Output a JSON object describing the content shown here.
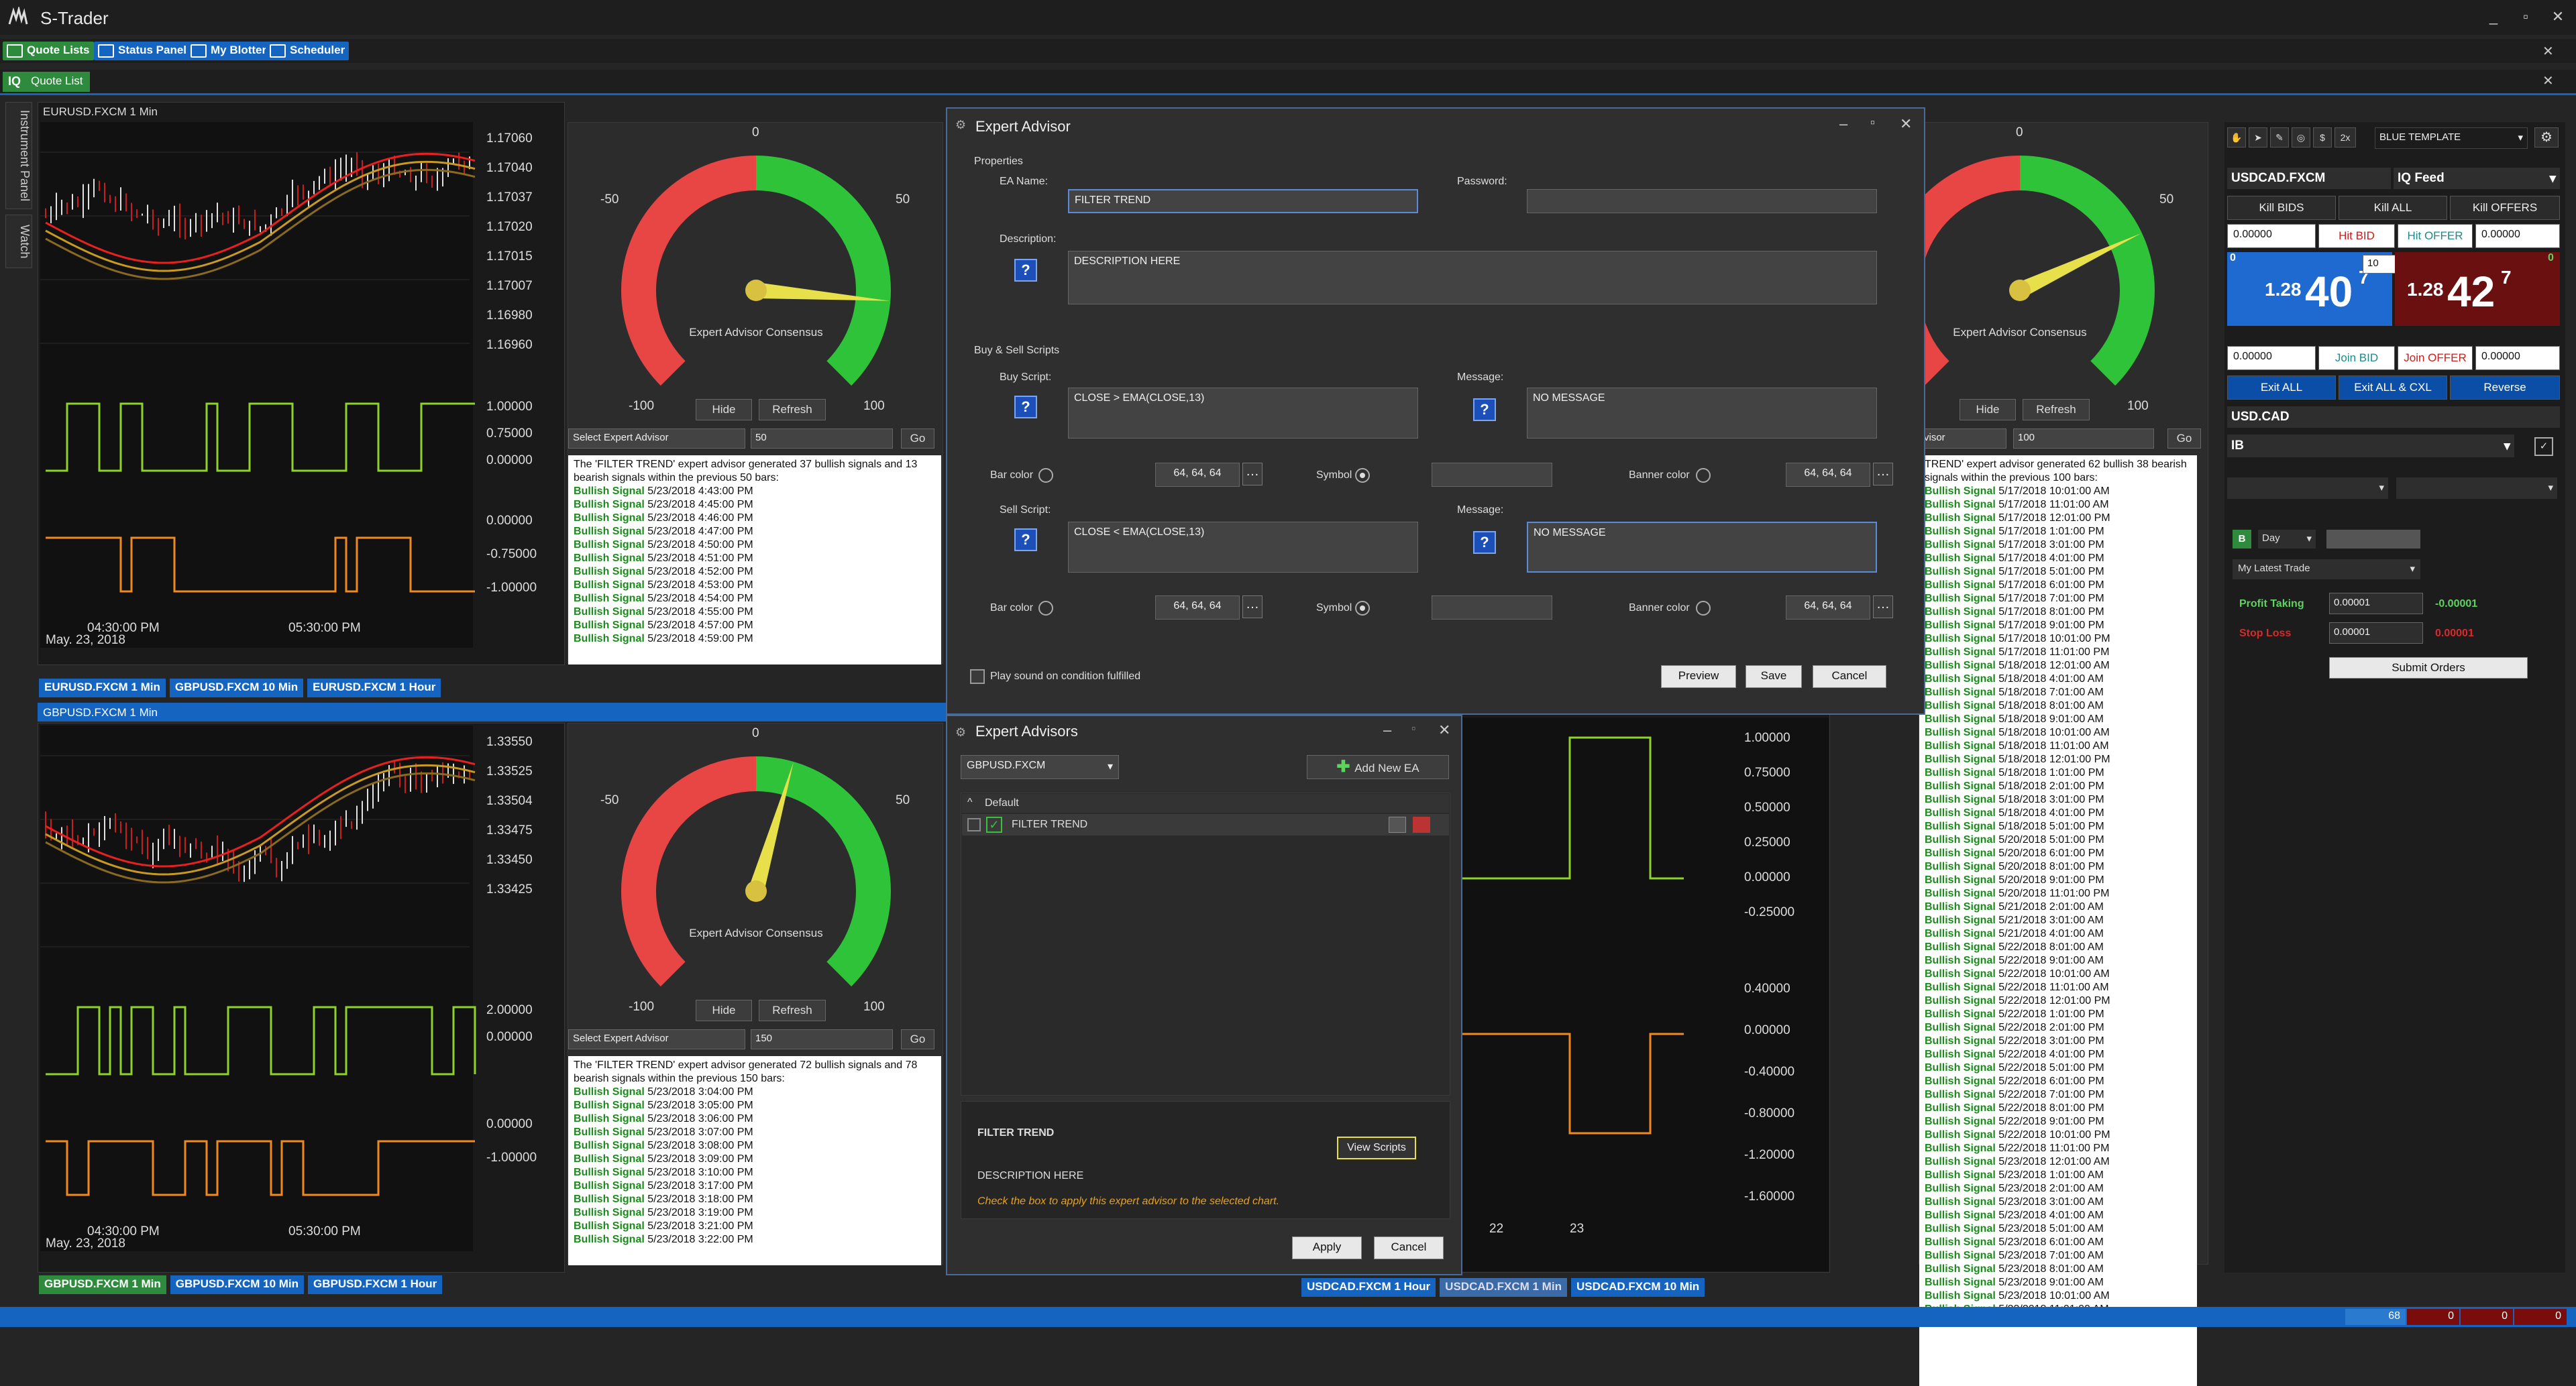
{
  "app": {
    "title": "S-Trader"
  },
  "menu": {
    "quote_lists": "Quote Lists",
    "status_panel": "Status Panel",
    "my_blotter": "My Blotter",
    "scheduler": "Scheduler"
  },
  "tabs": {
    "quote_list": "Quote List"
  },
  "side_tabs": {
    "instrument_panel": "Instrument Panel",
    "watch": "Watch"
  },
  "chart_top": {
    "title": "EURUSD.FXCM 1 Min",
    "price_ticks": [
      "1.17060",
      "1.17040",
      "1.17037",
      "1.17020",
      "1.17015",
      "1.17007",
      "1.16980",
      "1.16960"
    ],
    "ind1_ticks": [
      "1.00000",
      "0.75000",
      "0.00000"
    ],
    "ind2_ticks": [
      "0.00000",
      "-0.75000",
      "-1.00000"
    ],
    "time_ticks": [
      "04:30:00 PM",
      "05:30:00 PM"
    ],
    "date": "May. 23, 2018",
    "tabs": [
      "EURUSD.FXCM 1 Min",
      "GBPUSD.FXCM 10 Min",
      "EURUSD.FXCM 1 Hour"
    ]
  },
  "chart_bottom": {
    "title": "GBPUSD.FXCM 1 Min",
    "price_ticks": [
      "1.33550",
      "1.33525",
      "1.33504",
      "1.33475",
      "1.33450",
      "1.33425"
    ],
    "ind1_ticks": [
      "2.00000",
      "0.00000"
    ],
    "ind2_ticks": [
      "0.00000",
      "-1.00000"
    ],
    "time_ticks": [
      "04:30:00 PM",
      "05:30:00 PM"
    ],
    "date": "May. 23, 2018",
    "tabs": [
      "GBPUSD.FXCM 1 Min",
      "GBPUSD.FXCM 10 Min",
      "GBPUSD.FXCM 1 Hour"
    ]
  },
  "gauge_top": {
    "label": "Expert Advisor Consensus",
    "ticks": {
      "top": "0",
      "left": "-50",
      "right": "50",
      "min": "-100",
      "max": "100"
    },
    "value": 70,
    "hide": "Hide",
    "refresh": "Refresh",
    "select_placeholder": "Select Expert Advisor",
    "bars": "50",
    "go": "Go",
    "summary": "The 'FILTER TREND' expert advisor generated 37 bullish signals and 13 bearish signals within the previous 50 bars:",
    "signal_label": "Bullish Signal",
    "signals": [
      "5/23/2018 4:43:00 PM",
      "5/23/2018 4:45:00 PM",
      "5/23/2018 4:46:00 PM",
      "5/23/2018 4:47:00 PM",
      "5/23/2018 4:50:00 PM",
      "5/23/2018 4:51:00 PM",
      "5/23/2018 4:52:00 PM",
      "5/23/2018 4:53:00 PM",
      "5/23/2018 4:54:00 PM",
      "5/23/2018 4:55:00 PM",
      "5/23/2018 4:57:00 PM",
      "5/23/2018 4:59:00 PM"
    ]
  },
  "gauge_bottom": {
    "label": "Expert Advisor Consensus",
    "ticks": {
      "top": "0",
      "left": "-50",
      "right": "50",
      "min": "-100",
      "max": "100"
    },
    "value": 12,
    "hide": "Hide",
    "refresh": "Refresh",
    "select_placeholder": "Select Expert Advisor",
    "bars": "150",
    "go": "Go",
    "summary": "The 'FILTER TREND' expert advisor generated 72 bullish signals and 78 bearish signals within the previous 150 bars:",
    "signal_label": "Bullish Signal",
    "signals": [
      "5/23/2018 3:04:00 PM",
      "5/23/2018 3:05:00 PM",
      "5/23/2018 3:06:00 PM",
      "5/23/2018 3:07:00 PM",
      "5/23/2018 3:08:00 PM",
      "5/23/2018 3:09:00 PM",
      "5/23/2018 3:10:00 PM",
      "5/23/2018 3:17:00 PM",
      "5/23/2018 3:18:00 PM",
      "5/23/2018 3:19:00 PM",
      "5/23/2018 3:21:00 PM",
      "5/23/2018 3:22:00 PM"
    ]
  },
  "gauge_right": {
    "label": "Expert Advisor Consensus",
    "ticks": {
      "top": "0",
      "right": "50",
      "max": "100"
    },
    "value": 48,
    "hide": "Hide",
    "refresh": "Refresh",
    "select_placeholder": "visor",
    "bars": "100",
    "go": "Go",
    "summary": "TREND' expert advisor generated 62 bullish 38 bearish signals within the previous 100 bars:",
    "signal_label": "Bullish Signal",
    "signals": [
      "5/17/2018 10:01:00 AM",
      "5/17/2018 11:01:00 AM",
      "5/17/2018 12:01:00 PM",
      "5/17/2018 1:01:00 PM",
      "5/17/2018 3:01:00 PM",
      "5/17/2018 4:01:00 PM",
      "5/17/2018 5:01:00 PM",
      "5/17/2018 6:01:00 PM",
      "5/17/2018 7:01:00 PM",
      "5/17/2018 8:01:00 PM",
      "5/17/2018 9:01:00 PM",
      "5/17/2018 10:01:00 PM",
      "5/17/2018 11:01:00 PM",
      "5/18/2018 12:01:00 AM",
      "5/18/2018 4:01:00 AM",
      "5/18/2018 7:01:00 AM",
      "5/18/2018 8:01:00 AM",
      "5/18/2018 9:01:00 AM",
      "5/18/2018 10:01:00 AM",
      "5/18/2018 11:01:00 AM",
      "5/18/2018 12:01:00 PM",
      "5/18/2018 1:01:00 PM",
      "5/18/2018 2:01:00 PM",
      "5/18/2018 3:01:00 PM",
      "5/18/2018 4:01:00 PM",
      "5/18/2018 5:01:00 PM",
      "5/20/2018 5:01:00 PM",
      "5/20/2018 6:01:00 PM",
      "5/20/2018 8:01:00 PM",
      "5/20/2018 9:01:00 PM",
      "5/20/2018 11:01:00 PM",
      "5/21/2018 2:01:00 AM",
      "5/21/2018 3:01:00 AM",
      "5/21/2018 4:01:00 AM",
      "5/22/2018 8:01:00 AM",
      "5/22/2018 9:01:00 AM",
      "5/22/2018 10:01:00 AM",
      "5/22/2018 11:01:00 AM",
      "5/22/2018 12:01:00 PM",
      "5/22/2018 1:01:00 PM",
      "5/22/2018 2:01:00 PM",
      "5/22/2018 3:01:00 PM",
      "5/22/2018 4:01:00 PM",
      "5/22/2018 5:01:00 PM",
      "5/22/2018 6:01:00 PM",
      "5/22/2018 7:01:00 PM",
      "5/22/2018 8:01:00 PM",
      "5/22/2018 9:01:00 PM",
      "5/22/2018 10:01:00 PM",
      "5/22/2018 11:01:00 PM",
      "5/23/2018 12:01:00 AM",
      "5/23/2018 1:01:00 AM",
      "5/23/2018 2:01:00 AM",
      "5/23/2018 3:01:00 AM",
      "5/23/2018 4:01:00 AM",
      "5/23/2018 5:01:00 AM",
      "5/23/2018 6:01:00 AM",
      "5/23/2018 7:01:00 AM",
      "5/23/2018 8:01:00 AM",
      "5/23/2018 9:01:00 AM",
      "5/23/2018 10:01:00 AM",
      "5/23/2018 11:01:00 AM"
    ]
  },
  "chart_right": {
    "ind1_ticks": [
      "1.00000",
      "0.75000",
      "0.50000",
      "0.25000",
      "0.00000",
      "-0.25000"
    ],
    "ind2_ticks": [
      "0.40000",
      "0.00000",
      "-0.40000",
      "-0.80000",
      "-1.20000",
      "-1.60000"
    ],
    "time_ticks": [
      "22",
      "23"
    ],
    "tabs": [
      "USDCAD.FXCM 1 Hour",
      "USDCAD.FXCM 1 Min",
      "USDCAD.FXCM 10 Min"
    ]
  },
  "ea_dialog": {
    "title": "Expert Advisor",
    "properties": "Properties",
    "ea_name_label": "EA Name:",
    "ea_name": "FILTER TREND",
    "password_label": "Password:",
    "description_label": "Description:",
    "description": "DESCRIPTION HERE",
    "buy_sell": "Buy & Sell Scripts",
    "buy_script_label": "Buy Script:",
    "buy_script": "CLOSE > EMA(CLOSE,13)",
    "sell_script_label": "Sell Script:",
    "sell_script": "CLOSE < EMA(CLOSE,13)",
    "message_label": "Message:",
    "buy_message": "NO MESSAGE",
    "sell_message": "NO MESSAGE",
    "bar_color_label": "Bar color",
    "symbol_label": "Symbol",
    "banner_color_label": "Banner color",
    "color_value": "64, 64, 64",
    "play_sound": "Play sound on condition fulfilled",
    "preview": "Preview",
    "save": "Save",
    "cancel": "Cancel"
  },
  "eas_dialog": {
    "title": "Expert Advisors",
    "symbol": "GBPUSD.FXCM",
    "add_new": "Add New EA",
    "group": "Default",
    "item": "FILTER TREND",
    "detail_name": "FILTER TREND",
    "detail_desc": "DESCRIPTION HERE",
    "hint": "Check the box to apply this expert advisor to the selected chart.",
    "view_scripts": "View Scripts",
    "apply": "Apply",
    "cancel": "Cancel"
  },
  "trade": {
    "template": "BLUE TEMPLATE",
    "symbol": "USDCAD.FXCM",
    "feed": "IQ Feed",
    "kill_bids": "Kill BIDS",
    "kill_all": "Kill ALL",
    "kill_offers": "Kill OFFERS",
    "bid_qty": "0.00000",
    "hit_bid": "Hit BID",
    "hit_offer": "Hit OFFER",
    "offer_qty": "0.00000",
    "lots": "10",
    "bid_count": "0",
    "offer_count": "0",
    "bid_big": "1.28",
    "bid_pips": "40",
    "bid_sup": "7",
    "offer_big": "1.28",
    "offer_pips": "42",
    "offer_sup": "7",
    "join_qty_left": "0.00000",
    "join_bid": "Join BID",
    "join_offer": "Join OFFER",
    "join_qty_right": "0.00000",
    "exit_all": "Exit ALL",
    "exit_cxl": "Exit ALL & CXL",
    "reverse": "Reverse",
    "account_symbol": "USD.CAD",
    "broker": "IB",
    "side": "B",
    "tif": "Day",
    "strategy": "My Latest Trade",
    "profit_label": "Profit Taking",
    "profit_val": "0.00001",
    "profit_diff": "-0.00001",
    "stop_label": "Stop Loss",
    "stop_val": "0.00001",
    "stop_diff": "0.00001",
    "submit": "Submit Orders"
  },
  "status": {
    "v1": "68",
    "v2": "0",
    "v3": "0",
    "v4": "0"
  },
  "colors": {
    "accent": "#1565c0",
    "green": "#2e8b3e",
    "bull": "#1d8a1d",
    "red": "#c81e1e",
    "gauge_red": "#e84545",
    "gauge_green": "#2fc33a",
    "needle": "#e8e04a"
  }
}
